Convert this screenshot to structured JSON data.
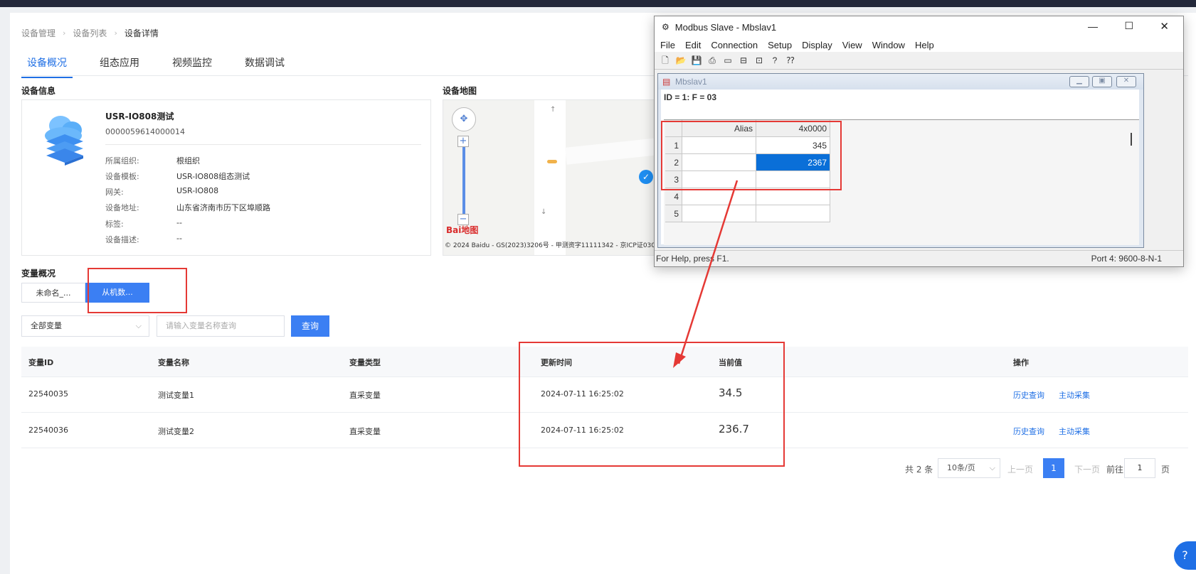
{
  "breadcrumb": [
    "设备管理",
    "设备列表",
    "设备详情"
  ],
  "tabs": [
    "设备概况",
    "组态应用",
    "视频监控",
    "数据调试"
  ],
  "device_info": {
    "section_title": "设备信息",
    "name": "USR-IO808测试",
    "serial": "0000059614000014",
    "rows": [
      {
        "k": "所属组织:",
        "v": "根组织"
      },
      {
        "k": "设备模板:",
        "v": "USR-IO808组态测试"
      },
      {
        "k": "网关:",
        "v": "USR-IO808"
      },
      {
        "k": "设备地址:",
        "v": "山东省济南市历下区埠顺路"
      },
      {
        "k": "标签:",
        "v": "--"
      },
      {
        "k": "设备描述:",
        "v": "--"
      }
    ]
  },
  "map": {
    "section_title": "设备地图",
    "copyright": "© 2024 Baidu - GS(2023)3206号 - 甲测资字11111342 - 京ICP证030",
    "logo": "Bai地图"
  },
  "variables": {
    "section_title": "变量概况",
    "segments": [
      "未命名_...",
      "从机数..."
    ],
    "filter_select": "全部变量",
    "search_placeholder": "请输入变量名称查询",
    "query_button": "查询",
    "headers": [
      "变量ID",
      "变量名称",
      "变量类型",
      "更新时间",
      "当前值",
      "操作"
    ],
    "rows": [
      {
        "id": "22540035",
        "name": "测试变量1",
        "type": "直采变量",
        "time": "2024-07-11 16:25:02",
        "value": "34.5",
        "op1": "历史查询",
        "op2": "主动采集"
      },
      {
        "id": "22540036",
        "name": "测试变量2",
        "type": "直采变量",
        "time": "2024-07-11 16:25:02",
        "value": "236.7",
        "op1": "历史查询",
        "op2": "主动采集"
      }
    ]
  },
  "pagination": {
    "total": "共 2 条",
    "page_size": "10条/页",
    "prev": "上一页",
    "current": "1",
    "next": "下一页",
    "goto_label": "前往",
    "goto_value": "1",
    "page_suffix": "页"
  },
  "modbus": {
    "title": "Modbus Slave - Mbslav1",
    "menu": [
      "File",
      "Edit",
      "Connection",
      "Setup",
      "Display",
      "View",
      "Window",
      "Help"
    ],
    "child_title": "Mbslav1",
    "id_line": "ID = 1: F = 03",
    "col_alias": "Alias",
    "col_addr": "4x0000",
    "row_nums": [
      "1",
      "2",
      "3",
      "4",
      "5"
    ],
    "values": [
      "345",
      "2367"
    ],
    "status_left": "For Help, press F1.",
    "status_right": "Port 4: 9600-8-N-1"
  },
  "colors": {
    "accent": "#1f6fe5",
    "primary_btn": "#3b7ff3",
    "highlight": "#e53935",
    "selected_cell": "#0a6fd8"
  }
}
